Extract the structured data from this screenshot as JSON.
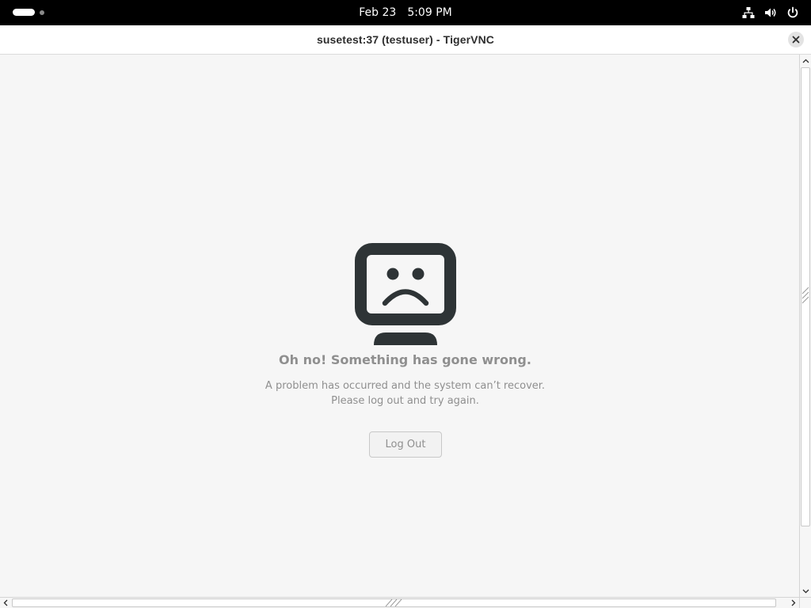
{
  "topbar": {
    "date": "Feb 23",
    "time": "5:09 PM",
    "icons": [
      "activities-indicator",
      "network-wired-icon",
      "volume-icon",
      "power-icon"
    ]
  },
  "window": {
    "title": "susetest:37 (testuser) - TigerVNC",
    "close_icon": "close-icon"
  },
  "error_screen": {
    "icon": "sad-computer-icon",
    "headline": "Oh no!  Something has gone wrong.",
    "message_line1": "A problem has occurred and the system can’t recover.",
    "message_line2": "Please log out and try again.",
    "button_label": "Log Out"
  },
  "colors": {
    "topbar_bg": "#000000",
    "content_bg": "#f6f6f6",
    "icon_dark": "#2e3436",
    "muted_text": "#8f8f8f"
  }
}
